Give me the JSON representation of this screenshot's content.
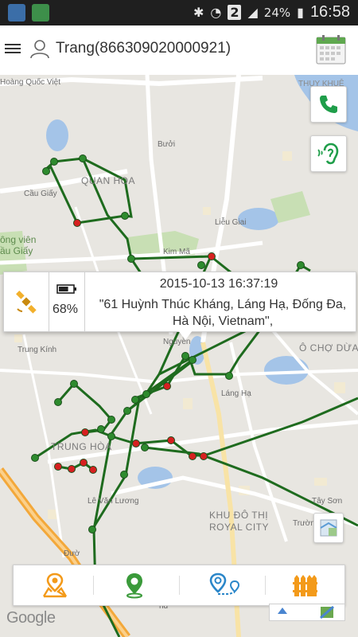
{
  "status_bar": {
    "sim_slot": "2",
    "battery": "24%",
    "time": "16:58"
  },
  "app_bar": {
    "title": "Trang(866309020000921)",
    "icons": {
      "menu": "menu-icon",
      "user": "user-icon",
      "calendar": "calendar-icon"
    }
  },
  "map": {
    "labels": {
      "quoc_viet": "Hoàng Quốc Việt",
      "thuy_khue": "THỤY KHUÊ",
      "quan_hoa": "QUAN HOA",
      "buoi": "Bưởi",
      "cau_giay": "Cầu Giấy",
      "cong_vien": "ông viên",
      "cau_giay2": "ầu Giấy",
      "kim_ma": "Kim Mã",
      "lieu_giai": "Liễu Giai",
      "lang_ha": "Láng Hạ",
      "o_cho_dua": "Ô CHỢ DỪA",
      "trung_kinh": "Trung Kính",
      "trung_hoa": "TRUNG HÒA",
      "nguyen": "Nguyễn",
      "le_van_luong": "Lê Văn Lương",
      "khu_do_thi": "KHU ĐÔ THỊ",
      "royal_city": "ROYAL CITY",
      "tay_son": "Tây Sơn",
      "truong": "Trường",
      "duong": "Đườ",
      "nd": "nđ"
    },
    "google": "Google"
  },
  "popup": {
    "datetime": "2015-10-13 16:37:19",
    "address": "\"61 Huỳnh Thúc Kháng, Láng Hạ, Đống Đa, Hà Nội, Vietnam\",",
    "battery_percent": "68%",
    "battery_level": 0.68,
    "location_source_icon": "satellite-icon"
  },
  "side_buttons": {
    "call": "phone-icon",
    "listen": "ear-icon",
    "layers": "map-layers-icon"
  },
  "bottom_bar": {
    "icons": [
      "map-pin-route-icon",
      "location-pin-icon",
      "route-pins-icon",
      "fence-icon"
    ]
  },
  "colors": {
    "track": "#1e6b1e",
    "point_green": "#2e8b2e",
    "point_red": "#d62020",
    "phone_green": "#1f9e4a",
    "orange": "#f39a1a",
    "blue": "#2a86c9"
  }
}
